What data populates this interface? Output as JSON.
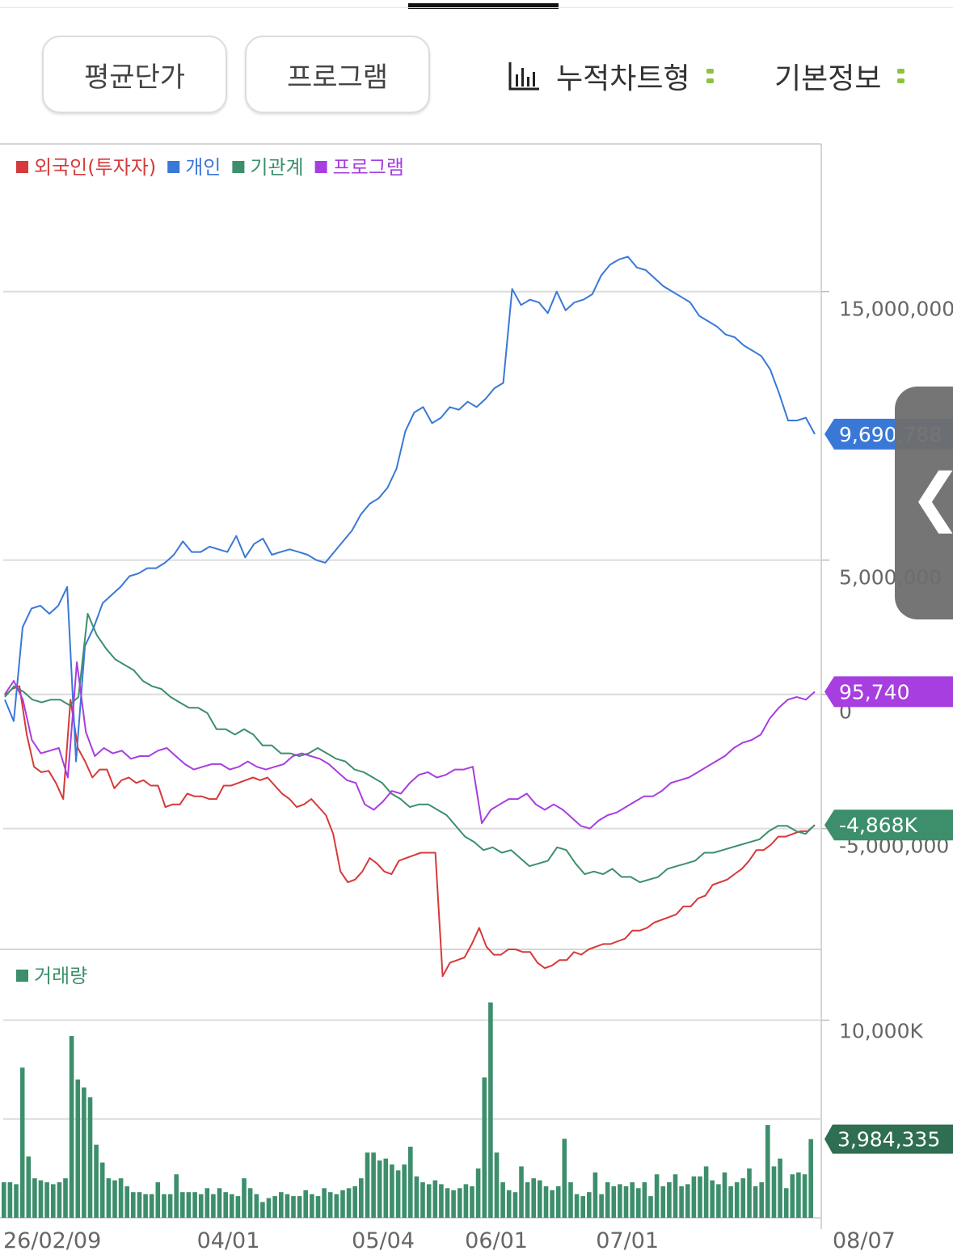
{
  "toolbar": {
    "average_price_label": "평균단가",
    "program_label": "프로그램",
    "cumulative_label": "누적차트형",
    "basic_info_label": "기본정보"
  },
  "side_handle": {
    "glyph": "❮"
  },
  "colors": {
    "foreign": "#d63a3a",
    "individual": "#3a78d8",
    "institution": "#3d8f6b",
    "program": "#a63ee0",
    "volume": "#3d8f6b",
    "volume_badge": "#2f6e50"
  },
  "chart_data": [
    {
      "type": "line",
      "legend": [
        "외국인(투자자)",
        "개인",
        "기관계",
        "프로그램"
      ],
      "y_ticks": [
        {
          "value": 15000000,
          "label": "15,000,000"
        },
        {
          "value": 5000000,
          "label": "5,000,000"
        },
        {
          "value": 0,
          "label": "0"
        },
        {
          "value": -5000000,
          "label": "-5,000,000"
        }
      ],
      "ylim": [
        -9500000,
        20500000
      ],
      "x_ticks": [
        {
          "index": 0,
          "label": "26/02/09"
        },
        {
          "index": 37,
          "label": "04/01"
        },
        {
          "index": 63,
          "label": "05/04"
        },
        {
          "index": 82,
          "label": "06/01"
        },
        {
          "index": 104,
          "label": "07/01"
        },
        {
          "index": 136,
          "label": "08/07"
        }
      ],
      "badges": [
        {
          "series": "개인",
          "label": "9,690,788",
          "value": 9690788
        },
        {
          "series": "프로그램",
          "label": "95,740",
          "value": 95740
        },
        {
          "series": "기관계",
          "label": "-4,868K",
          "value": -4868000
        }
      ],
      "series": [
        {
          "name": "외국인(투자자)",
          "values": [
            -50000,
            200000,
            300000,
            -1500000,
            -2700000,
            -2900000,
            -2850000,
            -3300000,
            -3900000,
            -200000,
            -2000000,
            -2500000,
            -3100000,
            -2800000,
            -2800000,
            -3500000,
            -3200000,
            -3100000,
            -3300000,
            -3200000,
            -3400000,
            -3400000,
            -4200000,
            -4100000,
            -4100000,
            -3700000,
            -3800000,
            -3800000,
            -3900000,
            -3900000,
            -3400000,
            -3400000,
            -3300000,
            -3200000,
            -3100000,
            -3200000,
            -3100000,
            -3400000,
            -3700000,
            -3900000,
            -4200000,
            -4100000,
            -3900000,
            -4200000,
            -4500000,
            -5200000,
            -6600000,
            -7000000,
            -6900000,
            -6600000,
            -6100000,
            -6300000,
            -6600000,
            -6700000,
            -6200000,
            -6100000,
            -6000000,
            -5900000,
            -5900000,
            -5900000,
            -10500000,
            -10000000,
            -9900000,
            -9800000,
            -9300000,
            -8700000,
            -9400000,
            -9700000,
            -9700000,
            -9500000,
            -9500000,
            -9600000,
            -9600000,
            -10000000,
            -10200000,
            -10100000,
            -9900000,
            -9900000,
            -9600000,
            -9700000,
            -9500000,
            -9400000,
            -9300000,
            -9300000,
            -9200000,
            -9100000,
            -8800000,
            -8800000,
            -8700000,
            -8500000,
            -8400000,
            -8300000,
            -8200000,
            -7900000,
            -7900000,
            -7600000,
            -7500000,
            -7100000,
            -7000000,
            -6900000,
            -6700000,
            -6500000,
            -6200000,
            -5800000,
            -5800000,
            -5600000,
            -5300000,
            -5300000,
            -5200000,
            -5100000,
            -5100000,
            -4868000
          ],
          "x_step": 1.2
        },
        {
          "name": "개인",
          "values": [
            -200000,
            -1000000,
            2500000,
            3200000,
            3300000,
            3000000,
            3300000,
            4000000,
            -2500000,
            1800000,
            2500000,
            3400000,
            3700000,
            4000000,
            4400000,
            4500000,
            4700000,
            4700000,
            4900000,
            5200000,
            5700000,
            5300000,
            5300000,
            5500000,
            5400000,
            5300000,
            5900000,
            5100000,
            5600000,
            5800000,
            5200000,
            5300000,
            5400000,
            5300000,
            5200000,
            5000000,
            4900000,
            5300000,
            5700000,
            6100000,
            6700000,
            7100000,
            7300000,
            7700000,
            8400000,
            9800000,
            10500000,
            10700000,
            10100000,
            10300000,
            10700000,
            10600000,
            10900000,
            10700000,
            11000000,
            11400000,
            11600000,
            15100000,
            14500000,
            14700000,
            14600000,
            14200000,
            15000000,
            14300000,
            14600000,
            14700000,
            14900000,
            15600000,
            16000000,
            16200000,
            16300000,
            15900000,
            15800000,
            15500000,
            15200000,
            15000000,
            14800000,
            14600000,
            14100000,
            13900000,
            13700000,
            13400000,
            13300000,
            13000000,
            12800000,
            12600000,
            12100000,
            11200000,
            10200000,
            10200000,
            10300000,
            9690788
          ],
          "x_step": 1.45
        },
        {
          "name": "기관계",
          "values": [
            -100000,
            300000,
            100000,
            -200000,
            -300000,
            -200000,
            -200000,
            -400000,
            -100000,
            3000000,
            2200000,
            1700000,
            1300000,
            1100000,
            900000,
            500000,
            300000,
            200000,
            -100000,
            -300000,
            -500000,
            -500000,
            -700000,
            -1300000,
            -1300000,
            -1500000,
            -1300000,
            -1500000,
            -1900000,
            -1900000,
            -2200000,
            -2200000,
            -2300000,
            -2200000,
            -2000000,
            -2200000,
            -2400000,
            -2500000,
            -2800000,
            -2900000,
            -3100000,
            -3300000,
            -3700000,
            -3900000,
            -4200000,
            -4100000,
            -4100000,
            -4300000,
            -4500000,
            -4900000,
            -5300000,
            -5500000,
            -5800000,
            -5700000,
            -5900000,
            -5800000,
            -6100000,
            -6400000,
            -6300000,
            -6200000,
            -5700000,
            -5800000,
            -6300000,
            -6700000,
            -6600000,
            -6700000,
            -6500000,
            -6800000,
            -6800000,
            -7000000,
            -6900000,
            -6800000,
            -6500000,
            -6400000,
            -6300000,
            -6200000,
            -5900000,
            -5900000,
            -5800000,
            -5700000,
            -5600000,
            -5500000,
            -5400000,
            -5100000,
            -4900000,
            -4900000,
            -5100000,
            -5200000,
            -4868000
          ],
          "x_step": 1.53
        },
        {
          "name": "프로그램",
          "values": [
            0,
            500000,
            -200000,
            -1700000,
            -2200000,
            -2100000,
            -2000000,
            -3100000,
            1200000,
            -1400000,
            -2300000,
            -2000000,
            -2200000,
            -2100000,
            -2400000,
            -2300000,
            -2300000,
            -2100000,
            -2000000,
            -2300000,
            -2600000,
            -2800000,
            -2700000,
            -2600000,
            -2600000,
            -2800000,
            -2700000,
            -2500000,
            -2700000,
            -2800000,
            -2700000,
            -2600000,
            -2300000,
            -2200000,
            -2300000,
            -2400000,
            -2600000,
            -2900000,
            -3200000,
            -3300000,
            -4100000,
            -4300000,
            -4000000,
            -3600000,
            -3700000,
            -3300000,
            -3000000,
            -2900000,
            -3100000,
            -3000000,
            -2800000,
            -2800000,
            -2700000,
            -4800000,
            -4300000,
            -4100000,
            -3900000,
            -3900000,
            -3700000,
            -4100000,
            -4300000,
            -4100000,
            -4300000,
            -4600000,
            -4900000,
            -5000000,
            -4700000,
            -4500000,
            -4400000,
            -4200000,
            -4000000,
            -3800000,
            -3800000,
            -3600000,
            -3300000,
            -3200000,
            -3100000,
            -2900000,
            -2700000,
            -2500000,
            -2300000,
            -2000000,
            -1800000,
            -1700000,
            -1500000,
            -900000,
            -500000,
            -200000,
            -100000,
            -200000,
            95740
          ],
          "x_step": 1.51
        }
      ]
    },
    {
      "type": "bar",
      "legend": [
        "거래량"
      ],
      "y_ticks": [
        {
          "value": 10000000,
          "label": "10,000K"
        }
      ],
      "ylim": [
        0,
        13500000
      ],
      "badge": {
        "label": "3,984,335",
        "value": 3984335
      },
      "values": [
        1800000,
        1800000,
        1700000,
        7600000,
        3100000,
        2000000,
        1900000,
        1800000,
        1700000,
        1800000,
        2000000,
        9200000,
        7000000,
        6600000,
        6100000,
        3700000,
        2800000,
        2000000,
        1900000,
        2000000,
        1600000,
        1300000,
        1300000,
        1200000,
        1200000,
        1800000,
        1200000,
        1200000,
        2200000,
        1300000,
        1300000,
        1300000,
        1200000,
        1500000,
        1200000,
        1500000,
        1300000,
        1200000,
        1100000,
        2000000,
        1500000,
        1200000,
        800000,
        1000000,
        1100000,
        1300000,
        1200000,
        1100000,
        1100000,
        1400000,
        1200000,
        1100000,
        1500000,
        1300000,
        1200000,
        1400000,
        1500000,
        1600000,
        2000000,
        3300000,
        3300000,
        2900000,
        3000000,
        2700000,
        2400000,
        2700000,
        3600000,
        2100000,
        1800000,
        1700000,
        1900000,
        1700000,
        1500000,
        1400000,
        1500000,
        1700000,
        1600000,
        2500000,
        7100000,
        10900000,
        3300000,
        1800000,
        1400000,
        1300000,
        2600000,
        1800000,
        2000000,
        1900000,
        1600000,
        1400000,
        1600000,
        4000000,
        1800000,
        1200000,
        1100000,
        1300000,
        2300000,
        1200000,
        1800000,
        1600000,
        1700000,
        1600000,
        1800000,
        1500000,
        1800000,
        1100000,
        2200000,
        1600000,
        1800000,
        2200000,
        1600000,
        1700000,
        2100000,
        2100000,
        2600000,
        1900000,
        1700000,
        2300000,
        1600000,
        1800000,
        2000000,
        2500000,
        1600000,
        1800000,
        4700000,
        2600000,
        3000000,
        1500000,
        2200000,
        2300000,
        2200000,
        3984335
      ]
    }
  ]
}
